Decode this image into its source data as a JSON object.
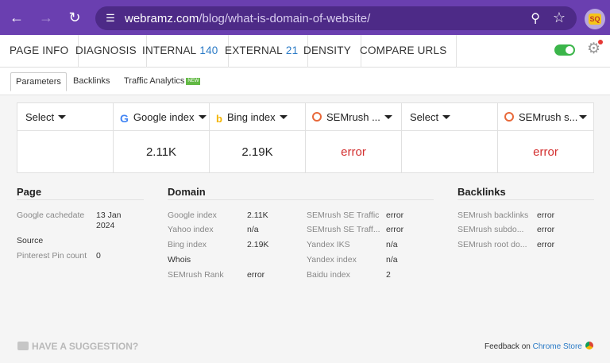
{
  "browser": {
    "url_host": "webramz.com",
    "url_path": "/blog/what-is-domain-of-website/",
    "back_icon": "back-arrow-icon",
    "forward_icon": "forward-arrow-icon",
    "reload_icon": "reload-icon",
    "extension_badge": "SQ"
  },
  "menu": [
    {
      "label": "PAGE INFO"
    },
    {
      "label": "DIAGNOSIS"
    },
    {
      "label": "INTERNAL",
      "count": "140"
    },
    {
      "label": "EXTERNAL",
      "count": "21"
    },
    {
      "label": "DENSITY"
    },
    {
      "label": "COMPARE URLS"
    }
  ],
  "subtabs": [
    "Parameters",
    "Backlinks",
    "Traffic Analytics"
  ],
  "subtab_badge": "NEW",
  "index_table": {
    "headers": [
      "Select",
      "Google index",
      "Bing index",
      "SEMrush ...",
      "Select",
      "SEMrush s..."
    ],
    "values": [
      "",
      "2.11K",
      "2.19K",
      "error",
      "",
      "error"
    ]
  },
  "page_section": {
    "title": "Page",
    "rows": [
      {
        "label": "Google cachedate",
        "value": "13 Jan\n2024"
      },
      {
        "label": "Source",
        "value": ""
      },
      {
        "label": "Pinterest Pin count",
        "value": "0"
      }
    ]
  },
  "domain_section": {
    "title": "Domain",
    "left_rows": [
      {
        "label": "Google index",
        "value": "2.11K"
      },
      {
        "label": "Yahoo index",
        "value": "n/a"
      },
      {
        "label": "Bing index",
        "value": "2.19K"
      },
      {
        "label": "Whois",
        "value": ""
      },
      {
        "label": "SEMrush Rank",
        "value": "error"
      }
    ],
    "right_rows": [
      {
        "label": "SEMrush SE Traffic",
        "value": "error"
      },
      {
        "label": "SEMrush SE Traff...",
        "value": "error"
      },
      {
        "label": "Yandex IKS",
        "value": "n/a"
      },
      {
        "label": "Yandex index",
        "value": "n/a"
      },
      {
        "label": "Baidu index",
        "value": "2"
      }
    ]
  },
  "backlinks_section": {
    "title": "Backlinks",
    "rows": [
      {
        "label": "SEMrush backlinks",
        "value": "error"
      },
      {
        "label": "SEMrush subdo...",
        "value": "error"
      },
      {
        "label": "SEMrush root do...",
        "value": "error"
      }
    ]
  },
  "footer": {
    "suggestion": "HAVE A SUGGESTION?",
    "feedback_prefix": "Feedback on",
    "feedback_link": "Chrome Store"
  },
  "colors": {
    "browser_bar": "#6a3fb0",
    "link": "#2a7ac6",
    "error": "#d32f2f",
    "toggle_on": "#3bb54a"
  }
}
